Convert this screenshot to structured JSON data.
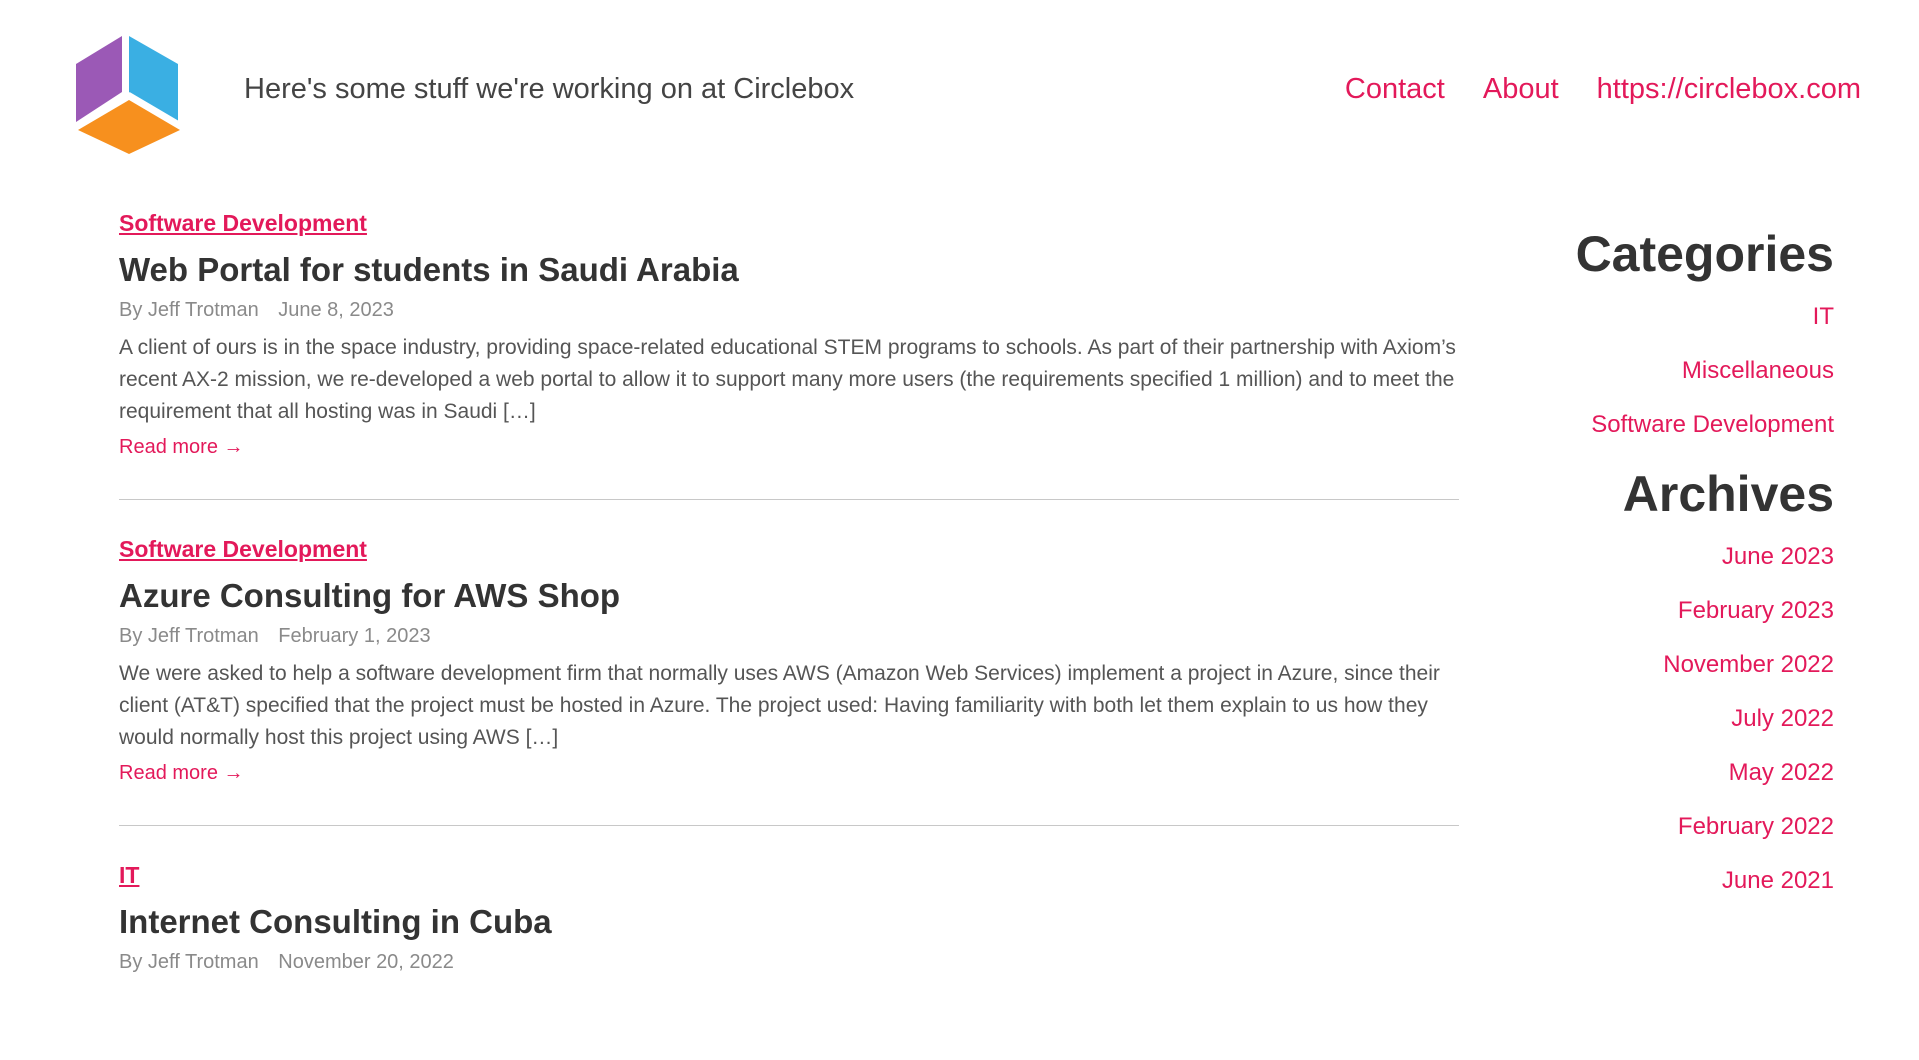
{
  "header": {
    "logo_icon": "circlebox-cube-logo",
    "tagline": "Here's some stuff we're working on at Circlebox",
    "nav": [
      "Contact",
      "About",
      "https://circlebox.com"
    ]
  },
  "posts": [
    {
      "category": "Software Development",
      "title": "Web Portal for students in Saudi Arabia",
      "author": "By Jeff Trotman",
      "date": "June 8, 2023",
      "excerpt": "A client of ours is in the space industry, providing space-related educational STEM programs to schools. As part of their partnership with Axiom’s recent AX-2 mission, we re-developed a web portal to allow it to support many more users (the requirements specified 1 million) and to meet the requirement that all hosting was in Saudi […]",
      "read_more": "Read more →"
    },
    {
      "category": "Software Development",
      "title": "Azure Consulting for AWS Shop",
      "author": "By Jeff Trotman",
      "date": "February 1, 2023",
      "excerpt": "We were asked to help a software development firm that normally uses AWS (Amazon Web Services) implement a project in Azure, since their client (AT&T) specified that the project must be hosted in Azure. The project used: Having familiarity with both let them explain to us how they would normally host this project using AWS […]",
      "read_more": "Read more →"
    },
    {
      "category": "IT",
      "title": "Internet Consulting in Cuba",
      "author": "By Jeff Trotman",
      "date": "November 20, 2022"
    }
  ],
  "sidebar": {
    "categories_heading": "Categories",
    "categories": [
      "IT",
      "Miscellaneous",
      "Software Development"
    ],
    "archives_heading": "Archives",
    "archives": [
      "June 2023",
      "February 2023",
      "November 2022",
      "July 2022",
      "May 2022",
      "February 2022",
      "June 2021"
    ]
  },
  "colors": {
    "accent": "#e3195a",
    "text": "#333333",
    "logo_blue": "#3aafe3",
    "logo_purple": "#9b59b6",
    "logo_orange": "#f7901e"
  }
}
